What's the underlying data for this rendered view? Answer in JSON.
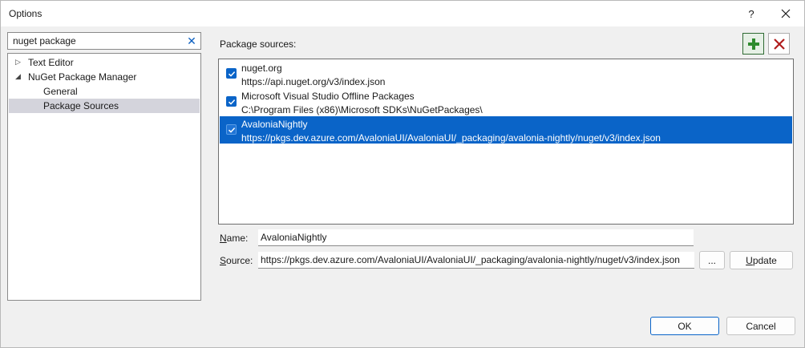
{
  "window": {
    "title": "Options",
    "help_label": "?"
  },
  "search": {
    "value": "nuget package",
    "clear_label": "✕"
  },
  "tree": {
    "items": [
      {
        "label": "Text Editor",
        "arrow": "▷"
      },
      {
        "label": "NuGet Package Manager",
        "arrow": "◢"
      },
      {
        "label": "General"
      },
      {
        "label": "Package Sources",
        "selected": true
      }
    ]
  },
  "package_sources": {
    "label": "Package sources:",
    "sources": [
      {
        "name": "nuget.org",
        "url": "https://api.nuget.org/v3/index.json",
        "checked": true
      },
      {
        "name": "Microsoft Visual Studio Offline Packages",
        "url": "C:\\Program Files (x86)\\Microsoft SDKs\\NuGetPackages\\",
        "checked": true
      },
      {
        "name": "AvaloniaNightly",
        "url": "https://pkgs.dev.azure.com/AvaloniaUI/AvaloniaUI/_packaging/avalonia-nightly/nuget/v3/index.json",
        "checked": true,
        "selected": true
      }
    ]
  },
  "form": {
    "name_label_accel": "N",
    "name_label_rest": "ame:",
    "name_value": "AvaloniaNightly",
    "source_label_accel": "S",
    "source_label_rest": "ource:",
    "source_value": "https://pkgs.dev.azure.com/AvaloniaUI/AvaloniaUI/_packaging/avalonia-nightly/nuget/v3/index.json",
    "browse_label": "...",
    "update_label_accel": "U",
    "update_label_rest": "pdate"
  },
  "footer": {
    "ok_label": "OK",
    "cancel_label": "Cancel"
  },
  "colors": {
    "accent": "#0a64c8",
    "add_green": "#2e8b2e",
    "remove_red": "#b01c1c"
  }
}
